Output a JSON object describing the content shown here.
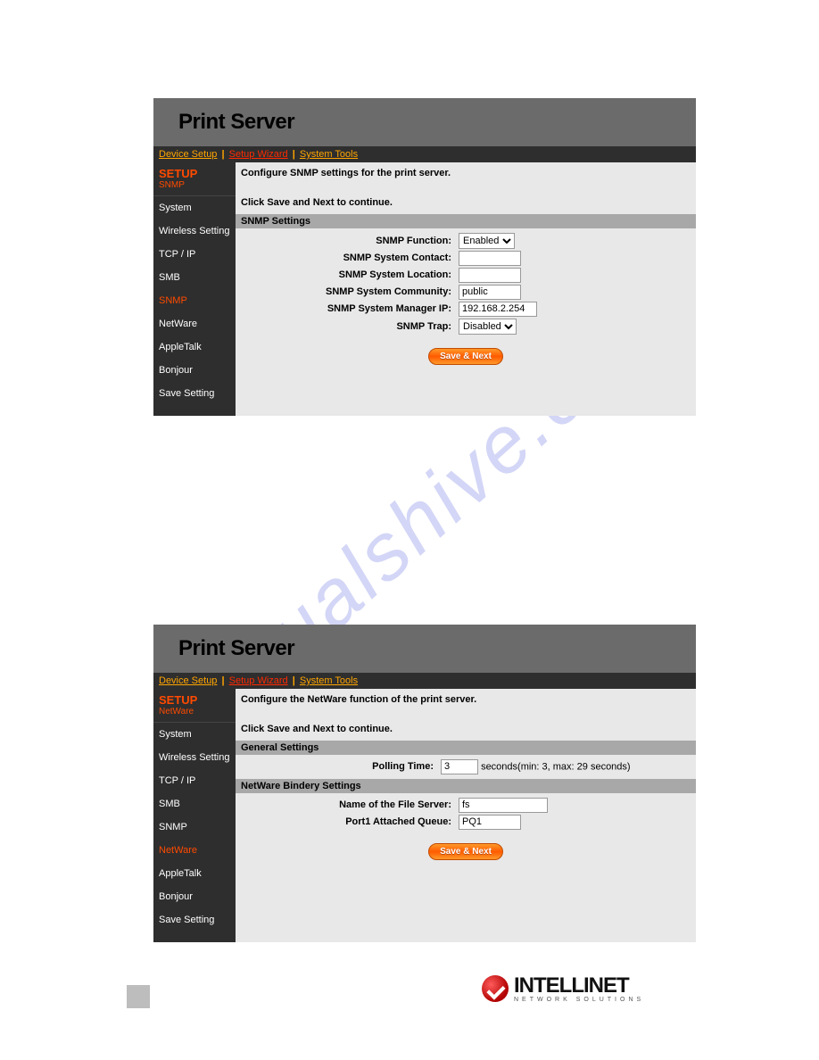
{
  "watermark": "manualshive.com",
  "footer": {
    "brand": "INTELLINET",
    "tagline": "NETWORK SOLUTIONS"
  },
  "snmp": {
    "title": "Print Server",
    "nav": {
      "device_setup": "Device Setup",
      "setup_wizard": "Setup Wizard",
      "system_tools": "System Tools"
    },
    "setup_heading": "SETUP",
    "setup_sub": "SNMP",
    "sidebar": [
      {
        "label": "System",
        "current": false
      },
      {
        "label": "Wireless Setting",
        "current": false
      },
      {
        "label": "TCP / IP",
        "current": false
      },
      {
        "label": "SMB",
        "current": false
      },
      {
        "label": "SNMP",
        "current": true
      },
      {
        "label": "NetWare",
        "current": false
      },
      {
        "label": "AppleTalk",
        "current": false
      },
      {
        "label": "Bonjour",
        "current": false
      },
      {
        "label": "Save Setting",
        "current": false
      }
    ],
    "intro_line1": "Configure SNMP settings for the print server.",
    "intro_line2": "Click Save and Next to continue.",
    "section_heading": "SNMP Settings",
    "fields": {
      "function": {
        "label": "SNMP Function:",
        "value": "Enabled"
      },
      "system_contact": {
        "label": "SNMP System Contact:",
        "value": ""
      },
      "system_location": {
        "label": "SNMP System Location:",
        "value": ""
      },
      "system_community": {
        "label": "SNMP System Community:",
        "value": "public"
      },
      "manager_ip": {
        "label": "SNMP System Manager IP:",
        "value": "192.168.2.254"
      },
      "trap": {
        "label": "SNMP Trap:",
        "value": "Disabled"
      }
    },
    "save_btn": "Save & Next"
  },
  "netware": {
    "title": "Print Server",
    "nav": {
      "device_setup": "Device Setup",
      "setup_wizard": "Setup Wizard",
      "system_tools": "System Tools"
    },
    "setup_heading": "SETUP",
    "setup_sub": "NetWare",
    "sidebar": [
      {
        "label": "System",
        "current": false
      },
      {
        "label": "Wireless Setting",
        "current": false
      },
      {
        "label": "TCP / IP",
        "current": false
      },
      {
        "label": "SMB",
        "current": false
      },
      {
        "label": "SNMP",
        "current": false
      },
      {
        "label": "NetWare",
        "current": true
      },
      {
        "label": "AppleTalk",
        "current": false
      },
      {
        "label": "Bonjour",
        "current": false
      },
      {
        "label": "Save Setting",
        "current": false
      }
    ],
    "intro_line1": "Configure the NetWare function of the print server.",
    "intro_line2": "Click Save and Next to continue.",
    "section_general": "General Settings",
    "polling": {
      "label": "Polling Time:",
      "value": "3",
      "suffix": "seconds(min: 3, max: 29 seconds)"
    },
    "section_bindery": "NetWare Bindery Settings",
    "fields": {
      "file_server": {
        "label": "Name of the File Server:",
        "value": "fs"
      },
      "port1_queue": {
        "label": "Port1 Attached Queue:",
        "value": "PQ1"
      }
    },
    "save_btn": "Save & Next"
  }
}
